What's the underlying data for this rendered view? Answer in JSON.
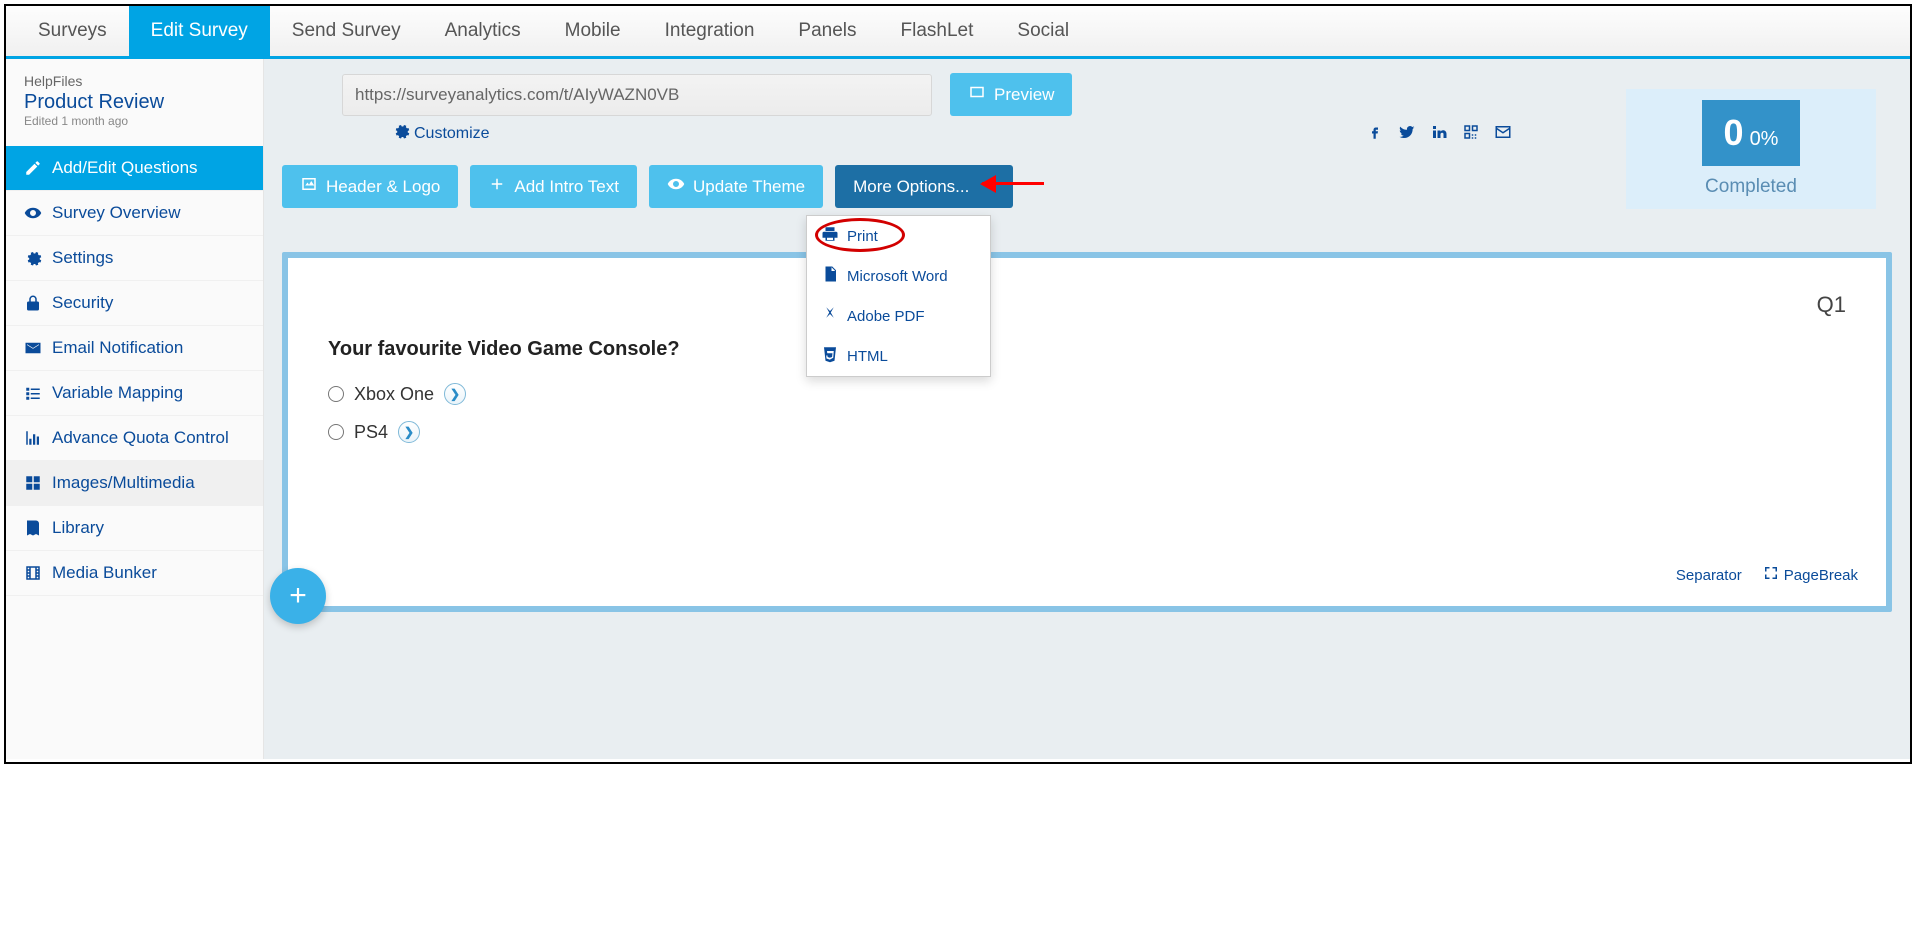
{
  "topnav": {
    "items": [
      "Surveys",
      "Edit Survey",
      "Send Survey",
      "Analytics",
      "Mobile",
      "Integration",
      "Panels",
      "FlashLet",
      "Social"
    ],
    "active": 1
  },
  "sidebar": {
    "subhead": "HelpFiles",
    "title": "Product Review",
    "edited": "Edited 1 month ago",
    "items": [
      {
        "icon": "edit",
        "label": "Add/Edit Questions"
      },
      {
        "icon": "eye",
        "label": "Survey Overview"
      },
      {
        "icon": "cogs",
        "label": "Settings"
      },
      {
        "icon": "lock",
        "label": "Security"
      },
      {
        "icon": "envelope",
        "label": "Email Notification"
      },
      {
        "icon": "list",
        "label": "Variable Mapping"
      },
      {
        "icon": "chart",
        "label": "Advance Quota Control"
      },
      {
        "icon": "grid",
        "label": "Images/Multimedia"
      },
      {
        "icon": "book",
        "label": "Library"
      },
      {
        "icon": "film",
        "label": "Media Bunker"
      }
    ],
    "active": 0,
    "sub": 7
  },
  "url": "https://surveyanalytics.com/t/AIyWAZN0VB",
  "preview_label": "Preview",
  "customize_label": "Customize",
  "share_icons": [
    "facebook",
    "twitter",
    "linkedin",
    "qrcode",
    "email"
  ],
  "stats": {
    "count": "0",
    "pct": "0%",
    "label": "Completed"
  },
  "actions": {
    "header_logo": "Header & Logo",
    "add_intro": "Add Intro Text",
    "update_theme": "Update Theme",
    "more_options": "More Options..."
  },
  "dropdown": [
    {
      "icon": "print",
      "label": "Print"
    },
    {
      "icon": "word",
      "label": "Microsoft Word"
    },
    {
      "icon": "pdf",
      "label": "Adobe PDF"
    },
    {
      "icon": "html",
      "label": "HTML"
    }
  ],
  "question": {
    "number": "Q1",
    "text": "Your favourite Video Game Console?",
    "options": [
      "Xbox One",
      "PS4"
    ],
    "separator": "Separator",
    "pagebreak": "PageBreak"
  },
  "fab": "+"
}
